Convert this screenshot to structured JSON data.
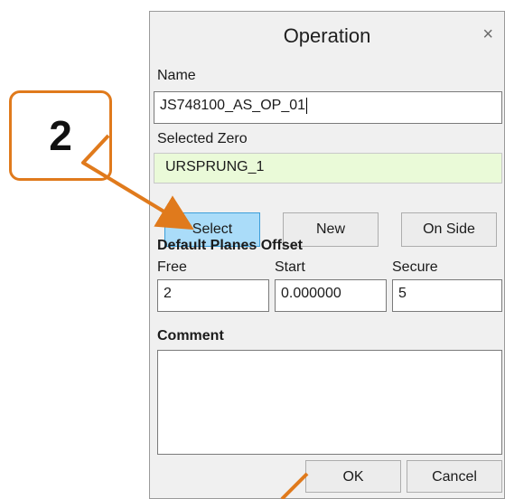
{
  "callout": {
    "number": "2",
    "color": "#e07a1c"
  },
  "dialog": {
    "title": "Operation",
    "close_glyph": "×",
    "name_label": "Name",
    "name_value": "JS748100_AS_OP_01",
    "zero_label": "Selected Zero",
    "zero_value": "URSPRUNG_1",
    "buttons": {
      "select": "Select",
      "new": "New",
      "on_side": "On Side"
    },
    "offset_title": "Default Planes Offset",
    "offsets": {
      "free_label": "Free",
      "free_value": "2",
      "start_label": "Start",
      "start_value": "0.000000",
      "secure_label": "Secure",
      "secure_value": "5"
    },
    "comment_label": "Comment",
    "comment_value": "",
    "ok_label": "OK",
    "cancel_label": "Cancel"
  }
}
